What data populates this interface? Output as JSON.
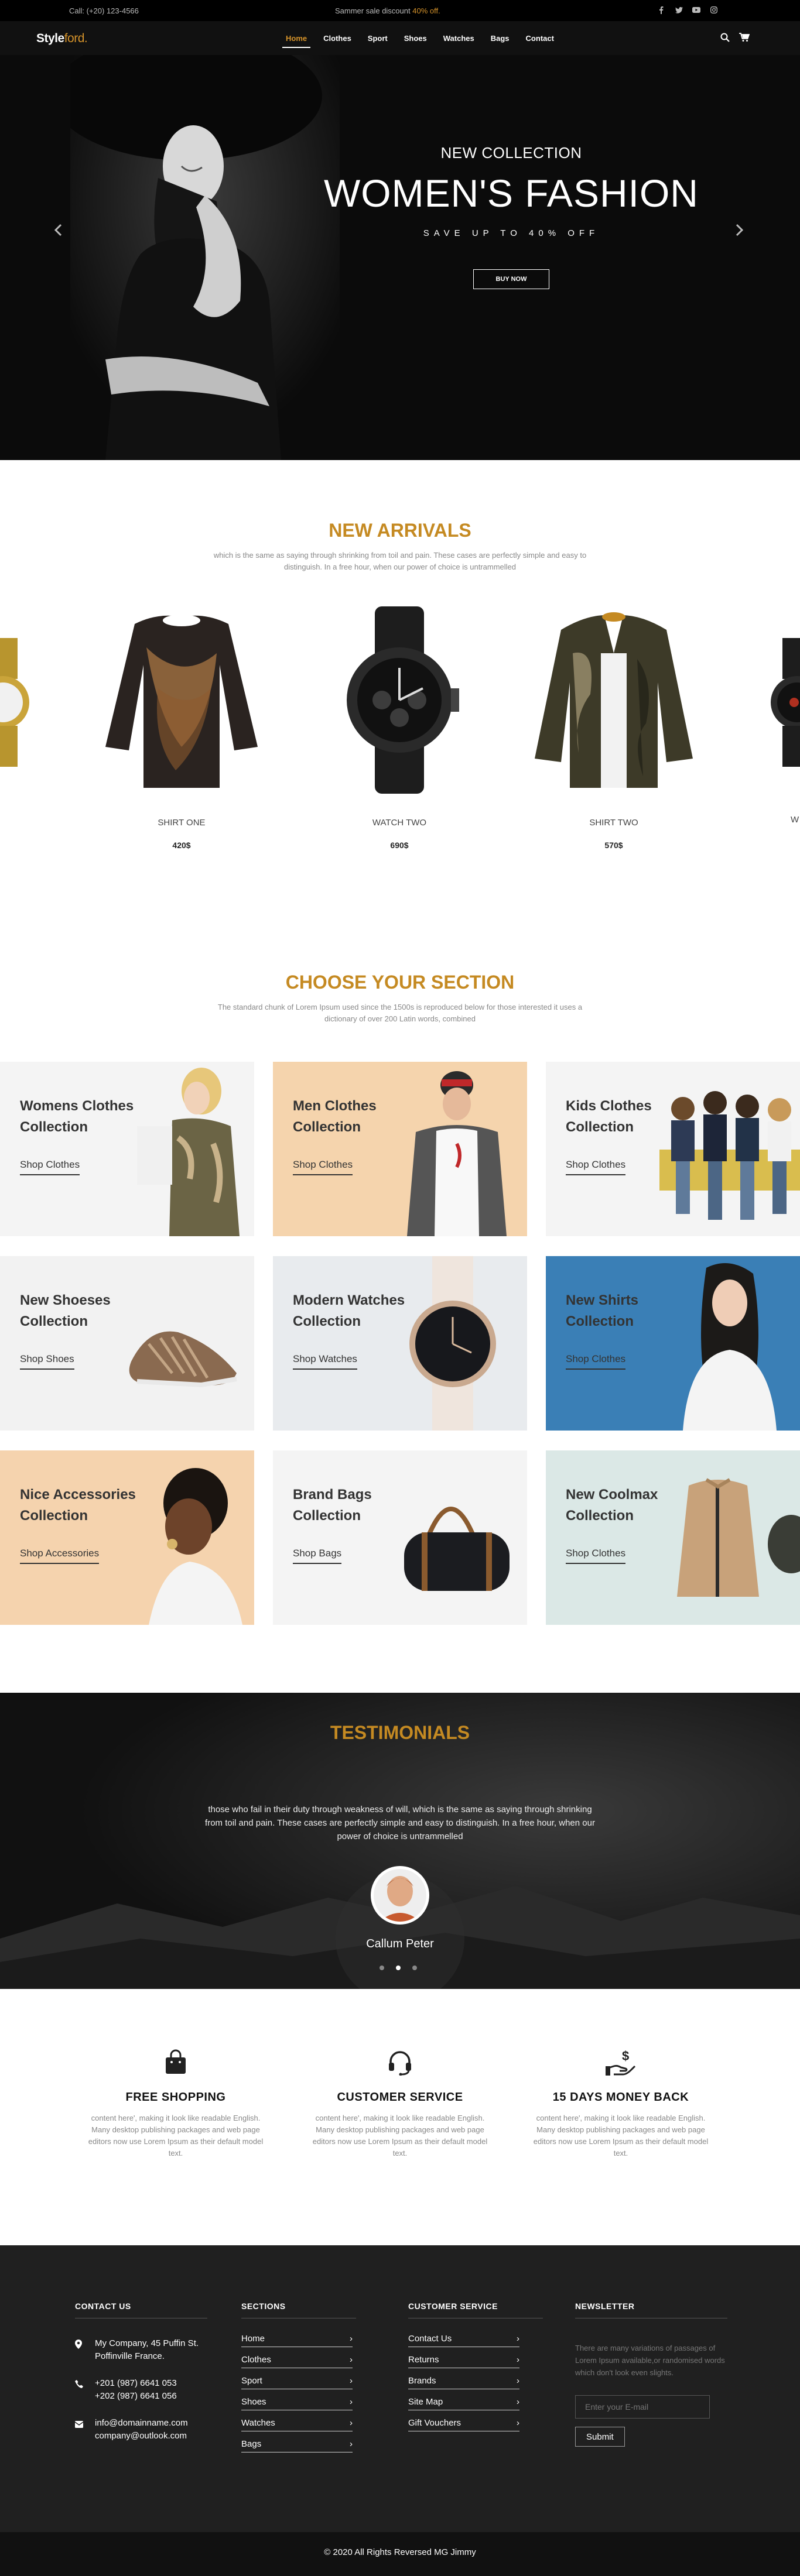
{
  "topbar": {
    "call": "Call: (+20) 123-4566",
    "promo_prefix": "Sammer sale discount ",
    "promo_highlight": "40% off."
  },
  "nav": {
    "brand_main": "Style",
    "brand_accent": "ford.",
    "menu": [
      "Home",
      "Clothes",
      "Sport",
      "Shoes",
      "Watches",
      "Bags",
      "Contact"
    ],
    "active": "Home"
  },
  "hero": {
    "kicker": "NEW COLLECTION",
    "headline": "WOMEN'S FASHION",
    "sub": "SAVE UP TO 40% OFF",
    "cta": "BUY NOW"
  },
  "arrivals": {
    "title": "NEW ARRIVALS",
    "desc": "which is the same as saying through shrinking from toil and pain. These cases are perfectly simple and easy to distinguish. In a free hour, when our power of choice is untrammelled",
    "products": [
      {
        "name": "SHIRT ONE",
        "price": "420$"
      },
      {
        "name": "WATCH TWO",
        "price": "690$"
      },
      {
        "name": "SHIRT TWO",
        "price": "570$"
      }
    ]
  },
  "choose": {
    "title": "CHOOSE YOUR SECTION",
    "desc": "The standard chunk of Lorem Ipsum used since the 1500s is reproduced below for those interested it uses a dictionary of over 200 Latin words, combined",
    "cards": [
      {
        "title": "Womens Clothes Collection",
        "link": "Shop Clothes"
      },
      {
        "title": "Men Clothes Collection",
        "link": "Shop Clothes"
      },
      {
        "title": "Kids Clothes Collection",
        "link": "Shop Clothes"
      },
      {
        "title": "New Shoeses Collection",
        "link": "Shop Shoes"
      },
      {
        "title": "Modern Watches Collection",
        "link": "Shop Watches"
      },
      {
        "title": "New Shirts Collection",
        "link": "Shop Clothes"
      },
      {
        "title": "Nice Accessories Collection",
        "link": "Shop Accessories"
      },
      {
        "title": "Brand Bags Collection",
        "link": "Shop Bags"
      },
      {
        "title": "New Coolmax Collection",
        "link": "Shop Clothes"
      }
    ]
  },
  "testimonials": {
    "title": "TESTIMONIALS",
    "quote": "those who fail in their duty through weakness of will, which is the same as saying through shrinking from toil and pain. These cases are perfectly simple and easy to distinguish. In a free hour, when our power of choice is untrammelled",
    "author": "Callum Peter"
  },
  "features": [
    {
      "title": "FREE SHOPPING",
      "text": "content here', making it look like readable English. Many desktop publishing packages and web page editors now use Lorem Ipsum as their default model text."
    },
    {
      "title": "CUSTOMER SERVICE",
      "text": "content here', making it look like readable English. Many desktop publishing packages and web page editors now use Lorem Ipsum as their default model text."
    },
    {
      "title": "15 DAYS MONEY BACK",
      "text": "content here', making it look like readable English. Many desktop publishing packages and web page editors now use Lorem Ipsum as their default model text."
    }
  ],
  "footer": {
    "contact": {
      "title": "CONTACT US",
      "address": "My Company, 45 Puffin St. Poffinville France.",
      "phone1": "+201 (987) 6641 053",
      "phone2": "+202 (987) 6641 056",
      "email1": "info@domainname.com",
      "email2": "company@outlook.com"
    },
    "sections": {
      "title": "SECTIONS",
      "links": [
        "Home",
        "Clothes",
        "Sport",
        "Shoes",
        "Watches",
        "Bags"
      ]
    },
    "service": {
      "title": "CUSTOMER SERVICE",
      "links": [
        "Contact Us",
        "Returns",
        "Brands",
        "Site Map",
        "Gift Vouchers"
      ]
    },
    "newsletter": {
      "title": "NEWSLETTER",
      "text": "There are many variations of passages of Lorem Ipsum available,or randomised words which don't look even slights.",
      "placeholder": "Enter your E-mail",
      "button": "Submit"
    }
  },
  "copyright": "© 2020 All Rights Reversed MG Jimmy"
}
